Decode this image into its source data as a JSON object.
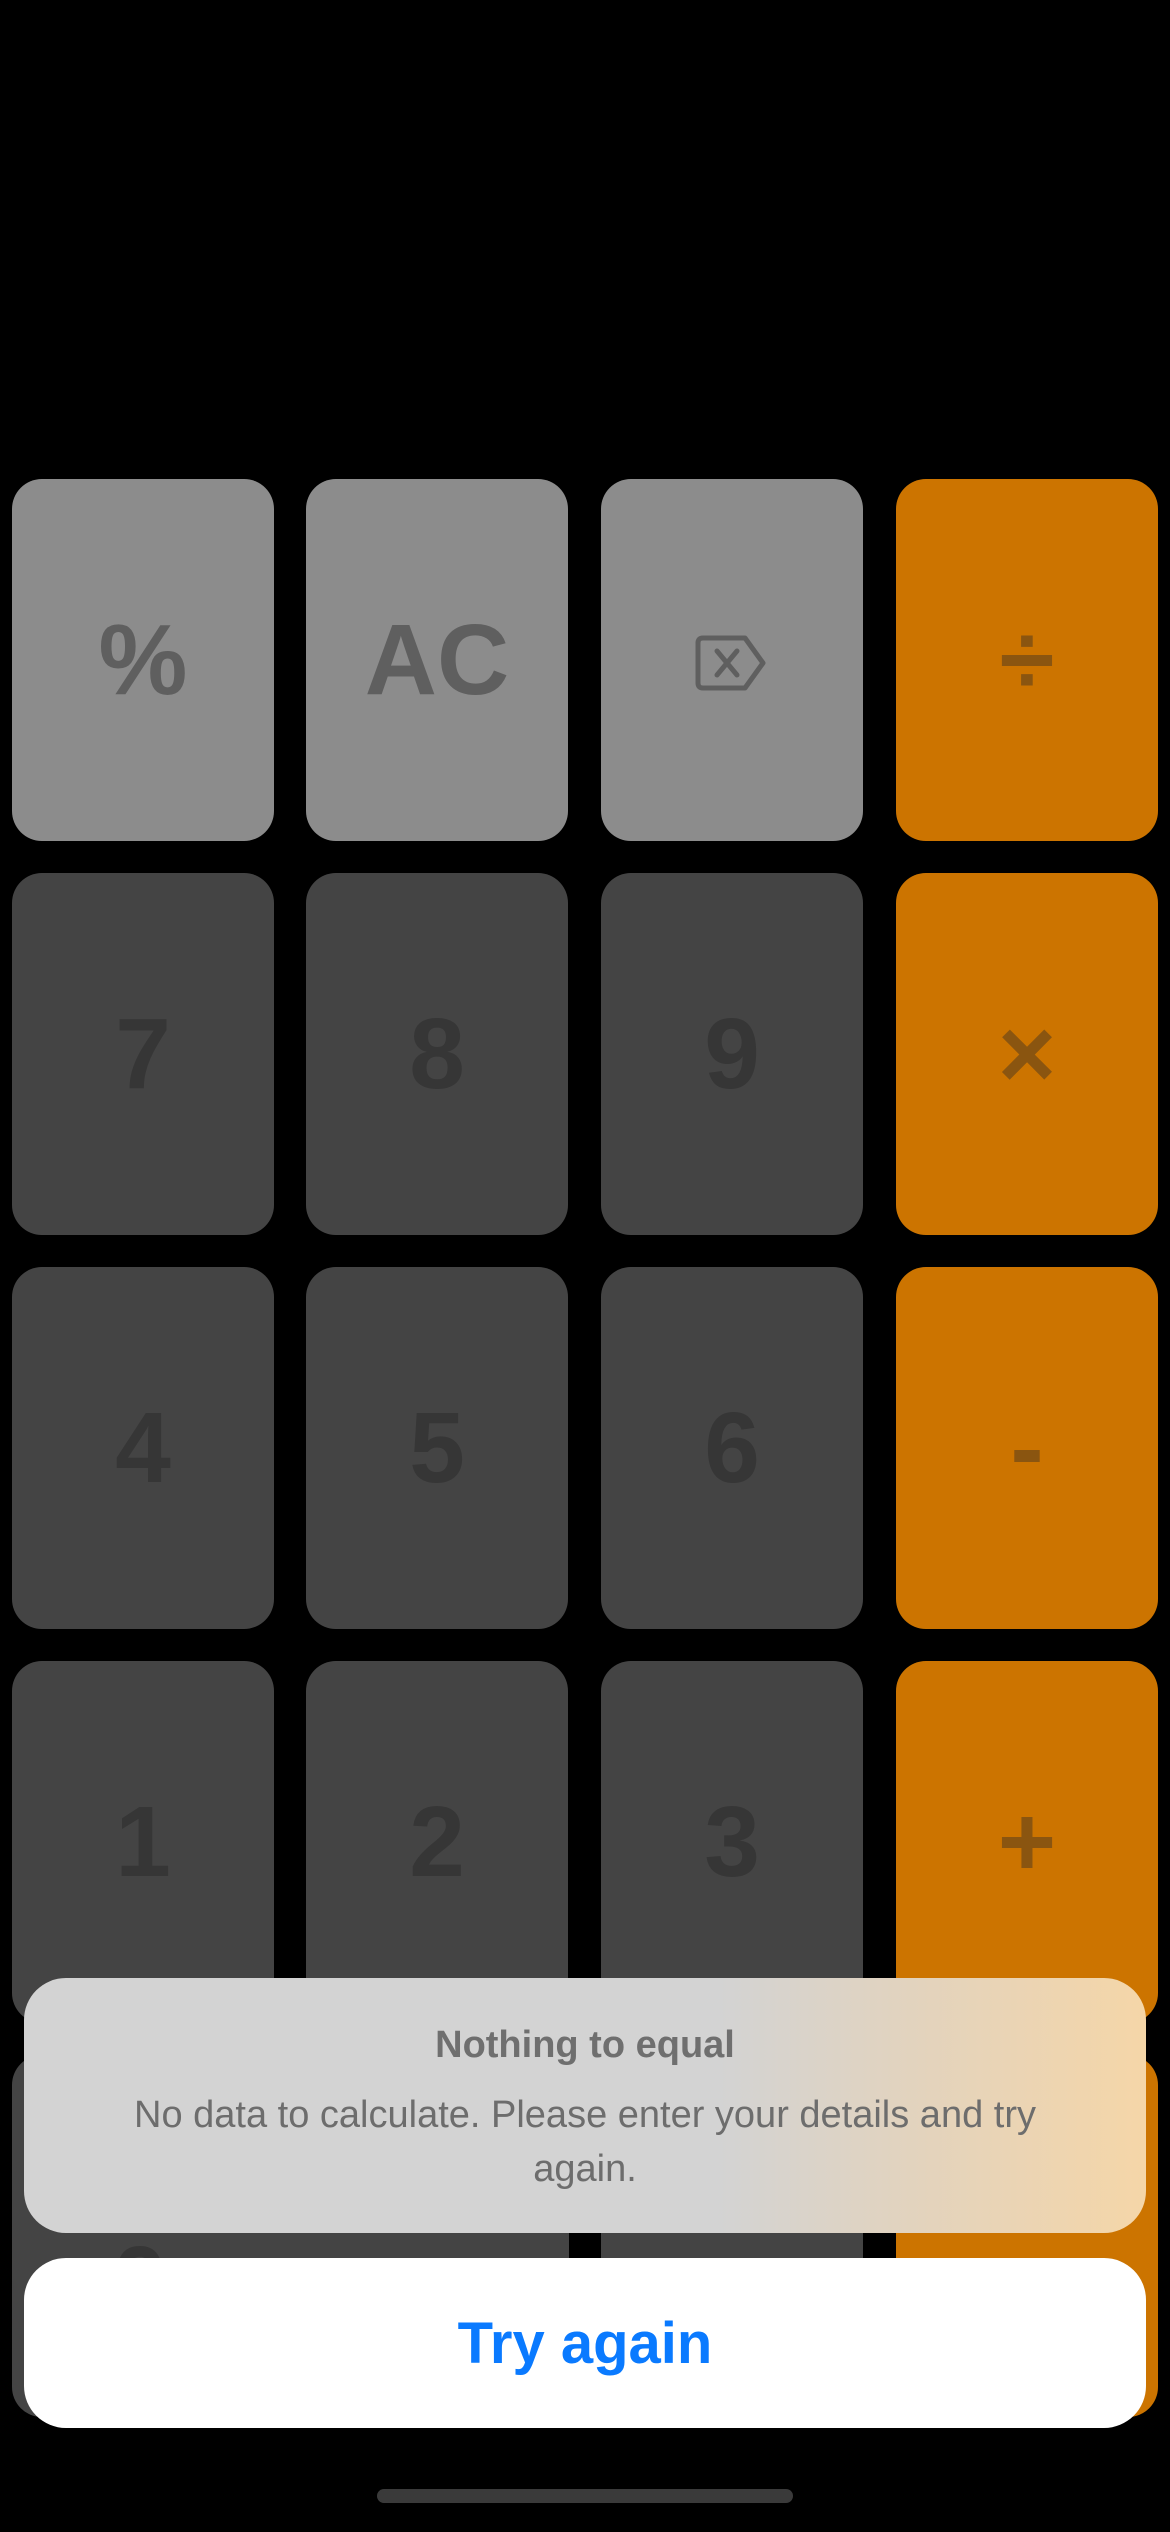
{
  "keypad": {
    "percent": "%",
    "clear": "AC",
    "divide": "÷",
    "seven": "7",
    "eight": "8",
    "nine": "9",
    "multiply": "×",
    "four": "4",
    "five": "5",
    "six": "6",
    "subtract": "-",
    "one": "1",
    "two": "2",
    "three": "3",
    "add": "+",
    "zero": "0",
    "equals": "="
  },
  "alert": {
    "title": "Nothing to equal",
    "message": "No data to calculate. Please enter your details and try again.",
    "button_label": "Try again"
  },
  "colors": {
    "function_key": "#8c8c8c",
    "number_key": "#444444",
    "operator_key": "#cc7400",
    "action_blue": "#0a7aff"
  }
}
